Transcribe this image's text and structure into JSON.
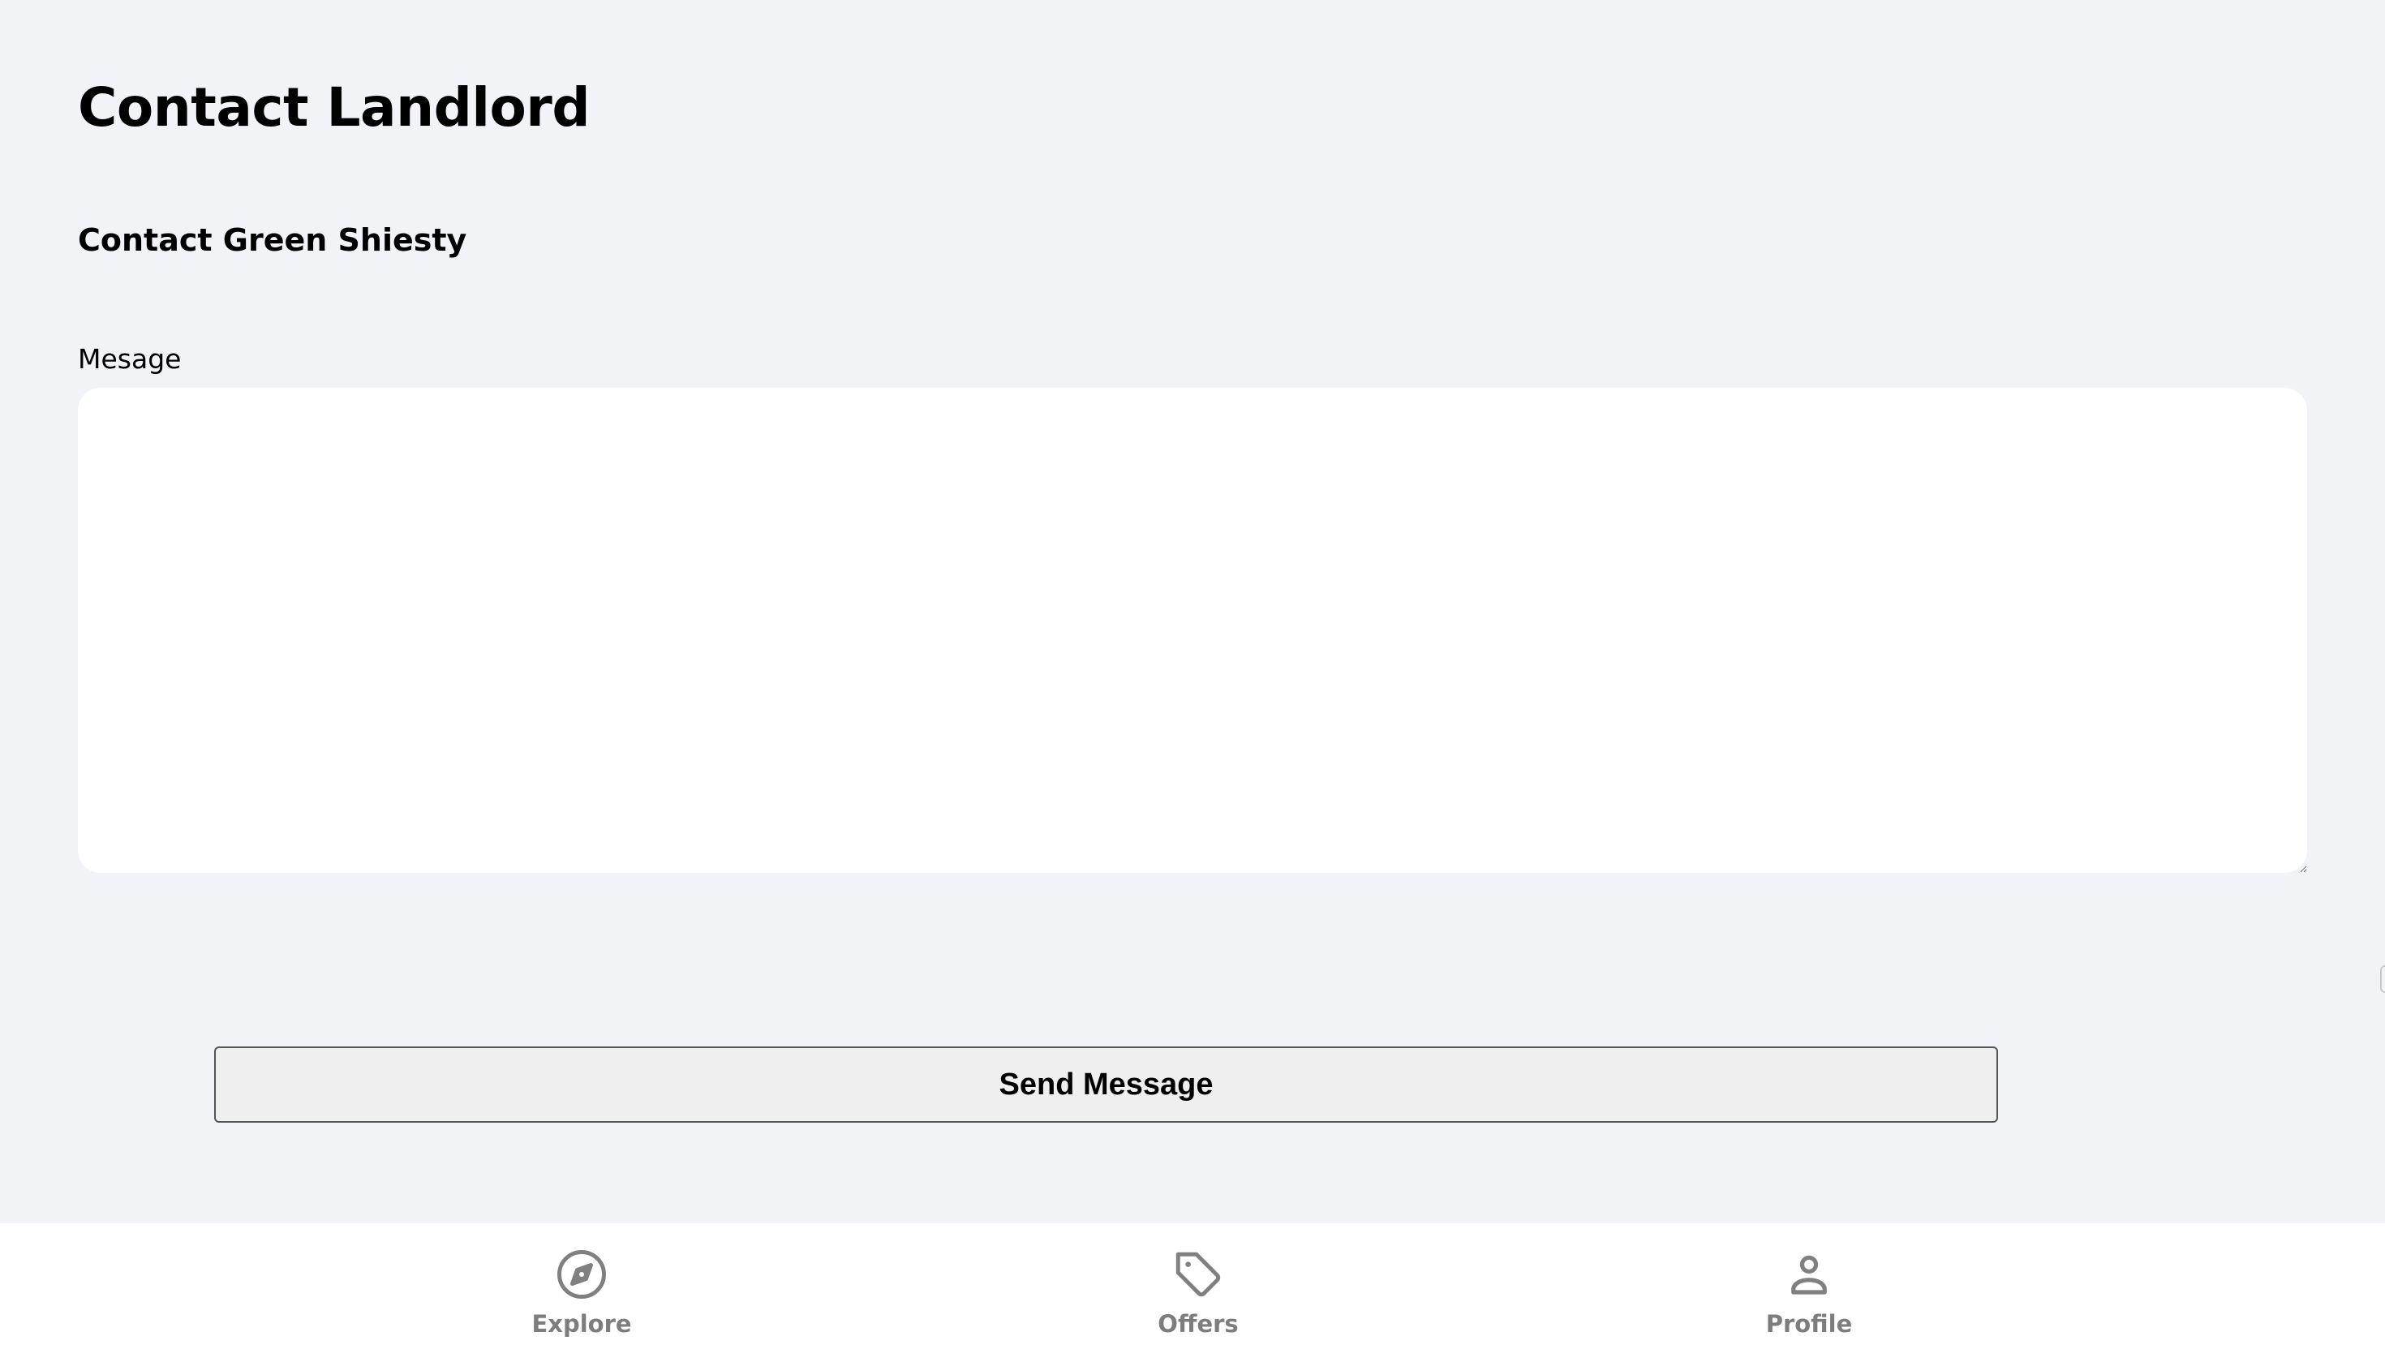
{
  "page": {
    "title": "Contact Landlord",
    "subtitle": "Contact Green Shiesty"
  },
  "form": {
    "message_label": "Mesage",
    "message_value": "",
    "send_label": "Send Message"
  },
  "nav": {
    "items": [
      {
        "label": "Explore",
        "icon": "compass-icon"
      },
      {
        "label": "Offers",
        "icon": "tag-icon"
      },
      {
        "label": "Profile",
        "icon": "user-icon"
      }
    ]
  },
  "colors": {
    "background": "#f2f3f6",
    "nav_inactive": "#808080"
  }
}
